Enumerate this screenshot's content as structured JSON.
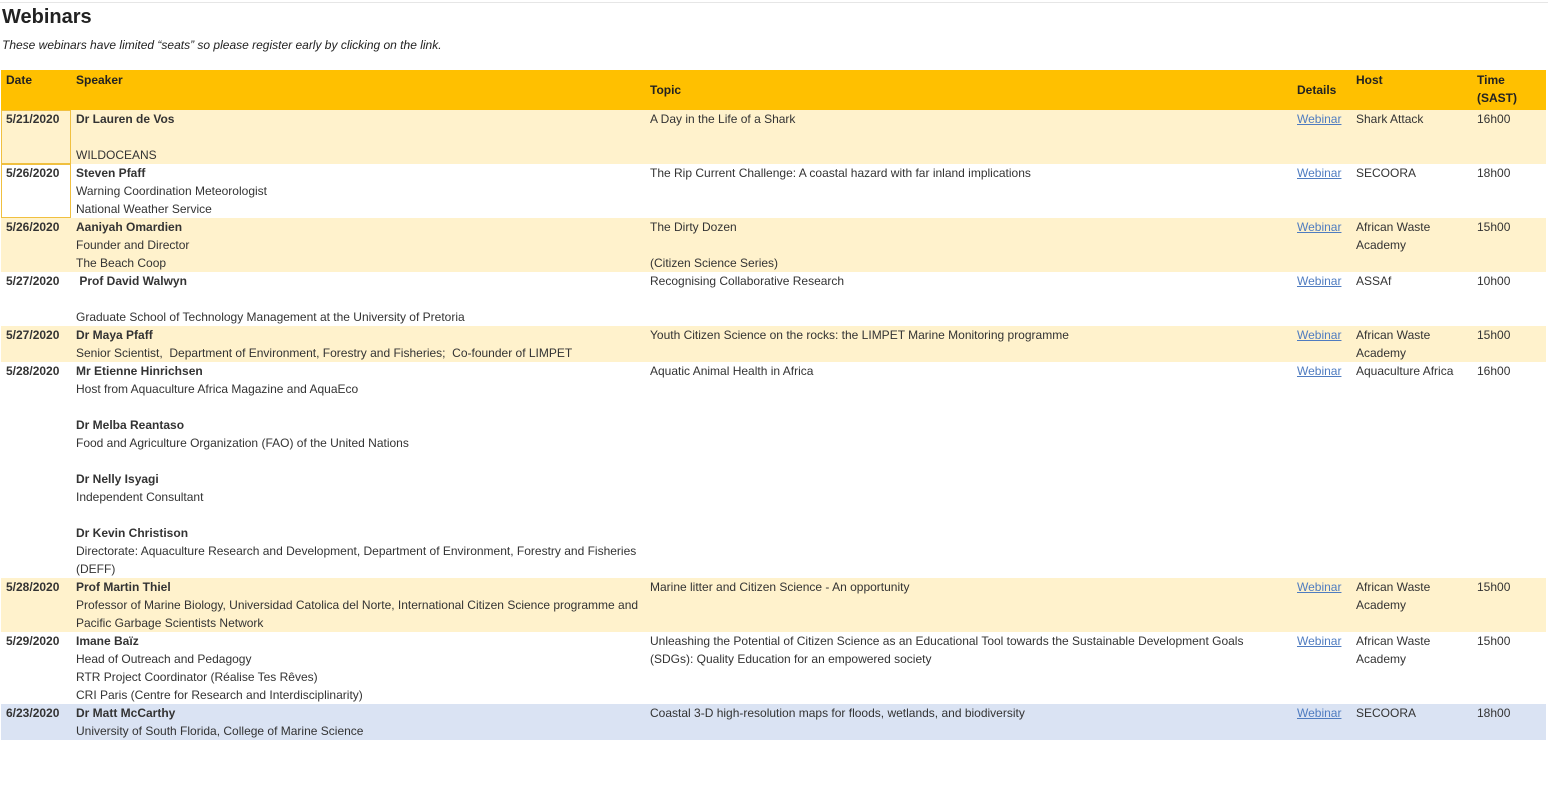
{
  "page": {
    "title": "Webinars",
    "subtitle": "These webinars have limited “seats” so please register early by clicking on the link."
  },
  "table": {
    "headers": {
      "date": "Date",
      "speaker": "Speaker",
      "topic": "Topic",
      "details": "Details",
      "host": "Host",
      "time_line1": "Time",
      "time_line2": "(SAST)"
    },
    "rows": [
      {
        "date": "5/21/2020",
        "speaker": [
          "Dr Lauren de Vos",
          "",
          "WILDOCEANS"
        ],
        "topic": [
          "A Day in the Life of a Shark"
        ],
        "details": "Webinar",
        "host": "Shark Attack",
        "time": "16h00"
      },
      {
        "date": "5/26/2020",
        "speaker": [
          "Steven Pfaff",
          "Warning Coordination Meteorologist",
          "National Weather Service"
        ],
        "topic": [
          "The Rip Current Challenge: A coastal hazard with far inland implications"
        ],
        "details": "Webinar",
        "host": "SECOORA",
        "time": "18h00"
      },
      {
        "date": "5/26/2020",
        "speaker": [
          "Aaniyah Omardien",
          "Founder and Director",
          "The Beach Coop"
        ],
        "topic": [
          "The Dirty Dozen",
          "",
          "(Citizen Science Series)"
        ],
        "details": "Webinar",
        "host": "African Waste Academy",
        "time": "15h00"
      },
      {
        "date": "5/27/2020",
        "speaker": [
          " Prof David Walwyn",
          "",
          "Graduate School of Technology Management at the University of Pretoria"
        ],
        "topic": [
          "Recognising Collaborative Research"
        ],
        "details": "Webinar",
        "host": "ASSAf",
        "time": "10h00"
      },
      {
        "date": "5/27/2020",
        "speaker": [
          "Dr Maya Pfaff",
          "Senior Scientist,  Department of Environment, Forestry and Fisheries;  Co-founder of LIMPET"
        ],
        "topic": [
          "Youth Citizen Science on the rocks: the LIMPET Marine Monitoring programme"
        ],
        "details": "Webinar",
        "host": "African Waste Academy",
        "time": "15h00"
      },
      {
        "date": "5/28/2020",
        "speaker": [
          "Mr Etienne Hinrichsen",
          "Host from Aquaculture Africa Magazine and AquaEco",
          "",
          "Dr Melba Reantaso",
          "Food and Agriculture Organization (FAO) of the United Nations",
          "",
          "Dr Nelly Isyagi",
          "Independent Consultant",
          "",
          "Dr Kevin Christison",
          "Directorate: Aquaculture Research and Development, Department of Environment, Forestry and Fisheries (DEFF)"
        ],
        "topic": [
          "Aquatic Animal Health in Africa"
        ],
        "details": "Webinar",
        "host": "Aquaculture Africa",
        "time": "16h00"
      },
      {
        "date": "5/28/2020",
        "speaker": [
          "Prof Martin Thiel",
          "Professor of Marine Biology, Universidad Catolica del Norte, International Citizen Science programme and Pacific Garbage Scientists Network"
        ],
        "topic": [
          "Marine litter and Citizen Science - An opportunity"
        ],
        "details": "Webinar",
        "host": "African Waste Academy",
        "time": "15h00"
      },
      {
        "date": "5/29/2020",
        "speaker": [
          "Imane Baïz",
          "Head of Outreach and Pedagogy",
          "RTR Project Coordinator (Réalise Tes Rêves)",
          "CRI Paris (Centre for Research and Interdisciplinarity)"
        ],
        "topic": [
          "Unleashing the Potential of Citizen Science as an Educational Tool towards the Sustainable Development Goals (SDGs): Quality Education for an empowered society"
        ],
        "details": "Webinar",
        "host": "African Waste Academy",
        "time": "15h00"
      },
      {
        "date": "6/23/2020",
        "speaker": [
          "Dr Matt McCarthy",
          "University of South Florida, College of Marine Science"
        ],
        "topic": [
          "Coastal 3-D high-resolution maps for floods, wetlands, and biodiversity"
        ],
        "details": "Webinar",
        "host": "SECOORA",
        "time": "18h00"
      }
    ]
  },
  "colors": {
    "header_bg": "#ffc000",
    "row_yellow": "#fff2cc",
    "row_blue": "#dae3f3",
    "link": "#4f7cc0"
  }
}
